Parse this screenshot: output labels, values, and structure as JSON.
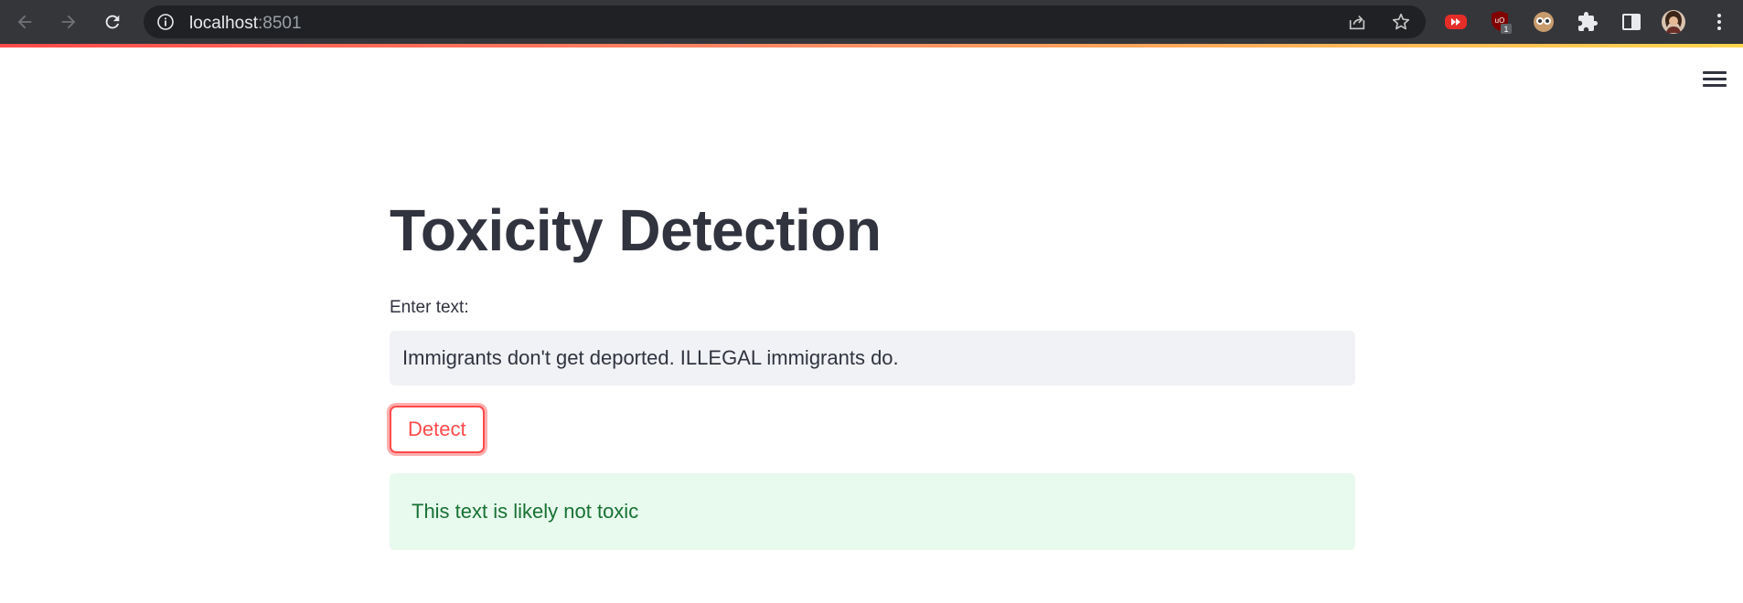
{
  "browser": {
    "url_host": "localhost",
    "url_port": ":8501",
    "icons": [
      "back-icon",
      "forward-icon",
      "reload-icon",
      "info-icon",
      "share-icon",
      "star-icon",
      "extensions-icon",
      "side-panel-icon",
      "menu-icon"
    ],
    "extensions": [
      {
        "name": "youtube-extension-icon",
        "color": "#e52d27"
      },
      {
        "name": "ublock-extension-icon",
        "color": "#800000",
        "badge": "1"
      },
      {
        "name": "owl-extension-icon",
        "color": "#c89b6d"
      }
    ]
  },
  "app": {
    "title": "Toxicity Detection",
    "input_label": "Enter text:",
    "input_value": "Immigrants don't get deported. ILLEGAL immigrants do.",
    "button_label": "Detect",
    "result_text": "This text is likely not toxic"
  },
  "colors": {
    "primary": "#ff4b4b",
    "text": "#31333f",
    "input_bg": "#f0f2f6",
    "success_bg": "#e8f9ee",
    "success_text": "#177233"
  }
}
